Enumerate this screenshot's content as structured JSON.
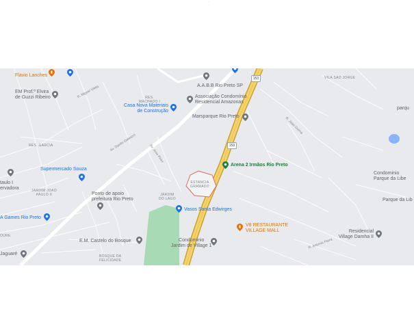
{
  "map": {
    "labels": {
      "flavio": "Flavio Lanches",
      "em_prof": "EM Prof.ª Elvira\nde Guzzi Ribeiro",
      "res_machado": "RES.\nMACHADO I",
      "aabb": "A.A.B.B Rio Preto SP",
      "associacao": "Associação Condomínio\nResidencial Amazonas",
      "casa_nova": "Casa Nova Materiais\nde Construção",
      "marsparque": "Marsparque Rio Preto",
      "vila_sao_jorge": "VILA SAO JORGE",
      "parque_right": "parqu",
      "res_garcia": "RES. GARCIA",
      "supermercado": "Supermercado Souza",
      "arena": "Arena 2 Irmãos Rio Preto",
      "estancia": "ESTANCIA\nGRAMADO",
      "condominio_parque": "Condominio\nParque da Libe",
      "jardim_joao": "JARDIM JOAO\nPAULO II",
      "ponto_apoio": "Ponto de apoio\nprefeitura Rio Preto",
      "jardim_do_lago": "JARDIM\nDO LAGO",
      "parque_da_lib": "Parque da Lib",
      "taulo": "taulo I\nervadora",
      "games": "A Games Rio Preto",
      "vasos": "Vasos Santa Edwirges",
      "v8": "V8 RESTAURANTE\nVILLAGE MALL",
      "residencial": "Residencial\nVillage Damha II",
      "em_castelo": "E.M. Castelo do Bosque",
      "cond_village": "Condominio\nJardim de Village 1",
      "bosque_felicidade": "BOSQUE DA\nFELICIDADE",
      "jaguare": "Jaguaré",
      "ouro": "OURE",
      "av_danilo": "Av. Danilo Galeazzi",
      "r_moreira": "R. Miguel Vilela",
      "av_dr_jose": "Av. Jose Pires",
      "r_joao": "R. Joao Guima",
      "r_antonio": "R. Antonio Parra"
    },
    "shields": {
      "s1": "153",
      "s2": "153"
    },
    "colors": {
      "background": "#e8eaed",
      "highway": "#f5d36a",
      "highway_edge": "#c9a233",
      "road": "#ffffff",
      "park": "#a8dab5",
      "water": "#8ab4f8",
      "estancia_outline": "#e06a5a"
    },
    "icons": [
      "food-pin-icon",
      "shop-pin-icon",
      "place-pin-icon",
      "park-pin-icon"
    ]
  }
}
